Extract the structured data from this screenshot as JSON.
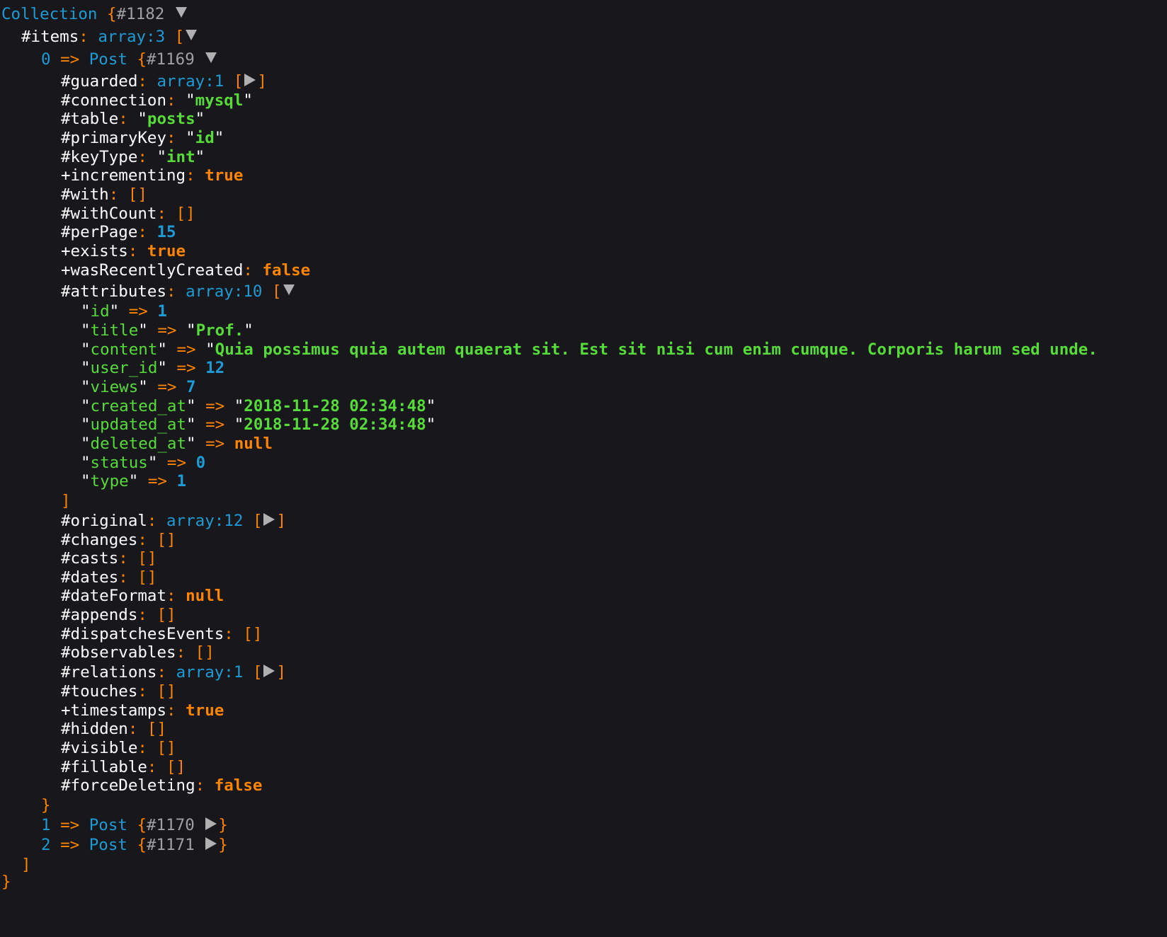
{
  "collection": {
    "class_name": "Collection",
    "ref": "#1182",
    "items_key": "#items",
    "items_type": "array:3"
  },
  "posts": [
    {
      "index": "0",
      "class_name": "Post",
      "ref": "#1169",
      "expanded": true
    },
    {
      "index": "1",
      "class_name": "Post",
      "ref": "#1170",
      "expanded": false
    },
    {
      "index": "2",
      "class_name": "Post",
      "ref": "#1171",
      "expanded": false
    }
  ],
  "post0": {
    "guarded": {
      "key": "#guarded",
      "type": "array:1"
    },
    "connection": {
      "key": "#connection",
      "value": "mysql"
    },
    "table": {
      "key": "#table",
      "value": "posts"
    },
    "primaryKey": {
      "key": "#primaryKey",
      "value": "id"
    },
    "keyType": {
      "key": "#keyType",
      "value": "int"
    },
    "incrementing": {
      "key": "+incrementing",
      "value": "true"
    },
    "with": {
      "key": "#with",
      "value": "[]"
    },
    "withCount": {
      "key": "#withCount",
      "value": "[]"
    },
    "perPage": {
      "key": "#perPage",
      "value": "15"
    },
    "exists": {
      "key": "+exists",
      "value": "true"
    },
    "wasRecentlyCreated": {
      "key": "+wasRecentlyCreated",
      "value": "false"
    },
    "attributes": {
      "key": "#attributes",
      "type": "array:10",
      "entries": [
        {
          "key": "id",
          "value": "1",
          "kind": "num"
        },
        {
          "key": "title",
          "value": "Prof.",
          "kind": "str"
        },
        {
          "key": "content",
          "value": "Quia possimus quia autem quaerat sit. Est sit nisi cum enim cumque. Corporis harum sed unde.",
          "kind": "str-open"
        },
        {
          "key": "user_id",
          "value": "12",
          "kind": "num"
        },
        {
          "key": "views",
          "value": "7",
          "kind": "num"
        },
        {
          "key": "created_at",
          "value": "2018-11-28 02:34:48",
          "kind": "str"
        },
        {
          "key": "updated_at",
          "value": "2018-11-28 02:34:48",
          "kind": "str"
        },
        {
          "key": "deleted_at",
          "value": "null",
          "kind": "const"
        },
        {
          "key": "status",
          "value": "0",
          "kind": "num"
        },
        {
          "key": "type",
          "value": "1",
          "kind": "num"
        }
      ]
    },
    "original": {
      "key": "#original",
      "type": "array:12"
    },
    "changes": {
      "key": "#changes",
      "value": "[]"
    },
    "casts": {
      "key": "#casts",
      "value": "[]"
    },
    "dates": {
      "key": "#dates",
      "value": "[]"
    },
    "dateFormat": {
      "key": "#dateFormat",
      "value": "null"
    },
    "appends": {
      "key": "#appends",
      "value": "[]"
    },
    "dispatchesEvents": {
      "key": "#dispatchesEvents",
      "value": "[]"
    },
    "observables": {
      "key": "#observables",
      "value": "[]"
    },
    "relations": {
      "key": "#relations",
      "type": "array:1"
    },
    "touches": {
      "key": "#touches",
      "value": "[]"
    },
    "timestamps": {
      "key": "+timestamps",
      "value": "true"
    },
    "hidden": {
      "key": "#hidden",
      "value": "[]"
    },
    "visible": {
      "key": "#visible",
      "value": "[]"
    },
    "fillable": {
      "key": "#fillable",
      "value": "[]"
    },
    "forceDeleting": {
      "key": "#forceDeleting",
      "value": "false"
    }
  },
  "colors": {
    "background": "#18171b",
    "class": "#1e9bd4",
    "punctuation": "#ff8400",
    "string": "#56db3a",
    "number": "#1e9bd4",
    "constant": "#ff8400",
    "ref": "#a0a0a0",
    "key": "#ffffff"
  },
  "icons": {
    "expanded": "caret-down-icon",
    "collapsed": "caret-right-icon"
  }
}
